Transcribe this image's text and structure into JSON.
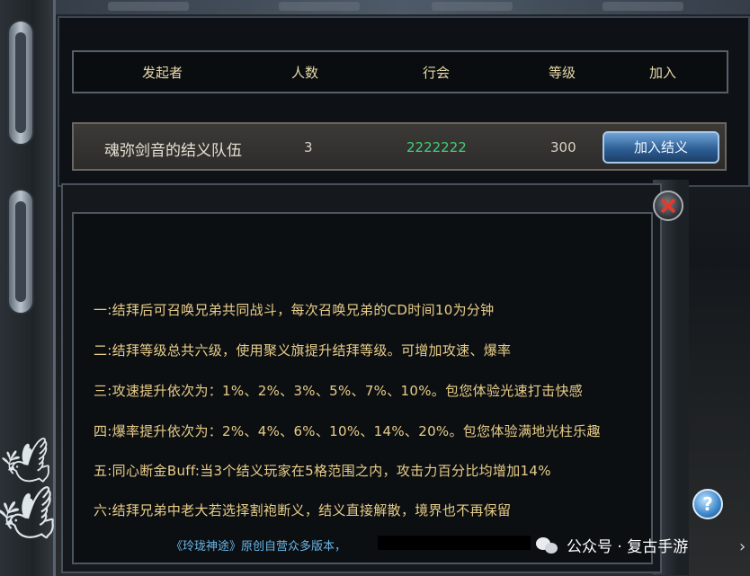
{
  "table": {
    "headers": {
      "initiator": "发起者",
      "members": "人数",
      "guild": "行会",
      "level": "等级",
      "join": "加入"
    },
    "row": {
      "name": "魂弥剑音的结义队伍",
      "members": "3",
      "guild": "2222222",
      "level": "300",
      "join_button": "加入结义"
    }
  },
  "rules": [
    "一:结拜后可召唤兄弟共同战斗，每次召唤兄弟的CD时间10为分钟",
    "二:结拜等级总共六级，使用聚义旗提升结拜等级。可增加攻速、爆率",
    "三:攻速提升依次为：1%、2%、3%、5%、7%、10%。包您体验光速打击快感",
    "四:爆率提升依次为：2%、4%、6%、10%、14%、20%。包您体验满地光柱乐趣",
    "五:同心断金Buff:当3个结义玩家在5格范围之内，攻击力百分比均增加14%",
    "六:结拜兄弟中老大若选择割袍断义，结义直接解散，境界也不再保留"
  ],
  "footer": "《玲珑神途》原创自营众多版本，",
  "help_button": "?",
  "watermark": "公众号 · 复古手游",
  "colors": {
    "header_text": "#e8d9a8",
    "guild_text": "#3fd07a",
    "rule_text": "#e8cd88",
    "footer_text": "#6ab6e8"
  },
  "icons": [
    "close-icon",
    "help-icon",
    "wechat-icon",
    "bird-decoration"
  ]
}
